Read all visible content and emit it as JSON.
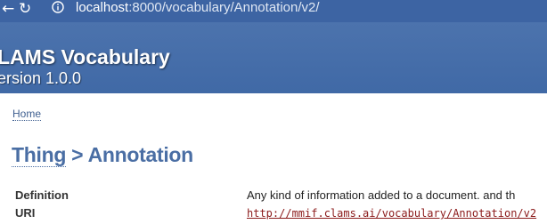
{
  "browser": {
    "url_host": "localhost",
    "url_rest": ":8000/vocabulary/Annotation/v2/",
    "back_icon": "arrow-left-icon",
    "reload_icon": "reload-icon",
    "site_info_icon": "site-info-icon"
  },
  "header": {
    "title": "LAMS Vocabulary",
    "version": "ersion 1.0.0"
  },
  "breadcrumb": {
    "home_label": "Home"
  },
  "page": {
    "parent_label": "Thing",
    "separator": " > ",
    "current_label": "Annotation"
  },
  "properties": {
    "definition_label": "Definition",
    "definition_value": "Any kind of information added to a document. and th",
    "uri_label": "URI",
    "uri_value": "http://mmif.clams.ai/vocabulary/Annotation/v2"
  },
  "colors": {
    "header_bg": "#4069a6",
    "browser_bg": "#3d64a3",
    "title_color": "#4a6ea4",
    "link_color": "#8b1a1a"
  }
}
